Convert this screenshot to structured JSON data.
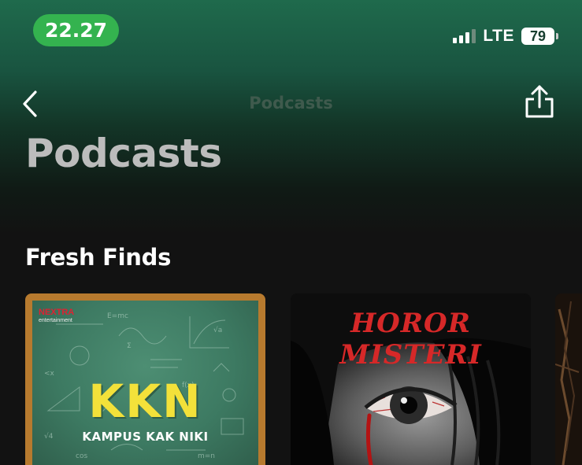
{
  "status_bar": {
    "time": "22.27",
    "network": "LTE",
    "battery": "79"
  },
  "nav": {
    "title": "Podcasts",
    "back_icon": "chevron-left-icon",
    "share_icon": "share-icon"
  },
  "page": {
    "title": "Podcasts"
  },
  "sections": [
    {
      "title": "Fresh Finds",
      "cards": [
        {
          "title": "KKN",
          "subtitle": "KAMPUS KAK NIKI",
          "publisher_logo": "NEXTRA",
          "publisher_sub": "entertainment"
        },
        {
          "title": "HOROR MISTERI"
        },
        {
          "title": ""
        }
      ]
    }
  ],
  "colors": {
    "time_pill": "#34b34f",
    "header_gradient_top": "#1f6a4c",
    "background": "#121212",
    "kkn_title": "#f3e13a",
    "horor_title": "#d62828"
  }
}
